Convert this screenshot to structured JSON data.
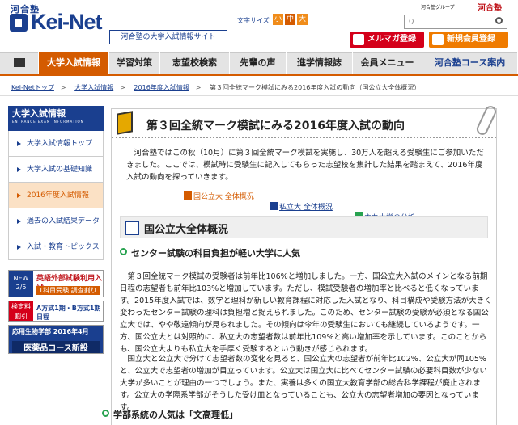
{
  "header": {
    "logo_small": "河合塾",
    "logo_text": "Kei-Net",
    "logo_sub": "河合塾の大学入試情報サイト",
    "fontsize_label": "文字サイズ",
    "fontsize_small": "小",
    "fontsize_medium": "中",
    "fontsize_large": "大",
    "group_text": "河合塾グループ",
    "group_logo": "河合塾",
    "search_placeholder": "Q",
    "magazine_button": "メルマガ登録",
    "member_button": "新規会員登録"
  },
  "nav": {
    "items": [
      "大学入試情報",
      "学習対策",
      "志望校検索",
      "先輩の声",
      "進学情報誌",
      "会員メニュー",
      "河合塾コース案内"
    ]
  },
  "breadcrumb": [
    "Kei-Netトップ",
    "大学入試情報",
    "2016年度入試情報",
    "第３回全統マーク模試にみる2016年度入試の動向（国公立大全体概況）"
  ],
  "sidebar": {
    "head_title": "大学入試情報",
    "head_sub": "ENTRANCE EXAM INFORMATION",
    "items": [
      "大学入試情報トップ",
      "大学入試の基礎知識",
      "2016年度入試情報",
      "過去の入試結果データ",
      "入試・教育トピックス"
    ],
    "banner1_key": "NEW 2/5",
    "banner1_a": "英語外部試験利用入試",
    "banner1_b": "1科目受験 調査割り",
    "banner2_key": "検定料 割引",
    "banner2_a": "A方式1期・B方式1期日程",
    "banner3_a": "応用生物学部 2016年4月",
    "banner3_b": "医薬品コース新設"
  },
  "main": {
    "title": "第３回全統マーク模試にみる2016年度入試の動向",
    "intro": "河合塾ではこの秋（10月）に第３回全統マーク模試を実施し、30万人を超える受験生にご参加いただきました。ここでは、模試時に受験生に記入してもらった志望校を集計した結果を踏まえて、2016年度入試の動向を探っていきます。",
    "tabs": [
      "国公立大 全体概況",
      "私立大 全体概況",
      "主な大学の分析"
    ],
    "section_title": "国公立大全体概況",
    "sub1": "センター試験の科目負担が軽い大学に人気",
    "para1": "第３回全統マーク模試の受験者は前年比106%と増加しました。一方、国公立大入試のメインとなる前期日程の志望者も前年比103%と増加しています。ただし、模試受験者の増加率と比べると低くなっています。2015年度入試では、数学と理科が新しい教育課程に対応した入試となり、科目構成や受験方法が大きく変わったセンター試験の理科は負担増と捉えられました。このため、センター試験の受験が必須となる国公立大では、やや敬遠傾向が見られました。その傾向は今年の受験生においても継続しているようです。一方、国公立大とは対照的に、私立大の志望者数は前年比109%と高い増加率を示しています。このことからも、国公立大よりも私立大を手厚く受験するという動きが感じられます。",
    "para2": "国立大と公立大で分けて志望者数の変化を見ると、国公立大の志望者が前年比102%、公立大が同105%と、公立大で志望者の増加が目立っています。公立大は国立大に比べてセンター試験の必要科目数が少ない大学が多いことが理由の一つでしょう。また、実養は多くの国立大教育学部の総合科学課程が廃止されます。公立大の学際系学部がそうした受け皿となっていることも、公立大の志望者増加の要因となっています。",
    "sub2": "学部系統の人気は「文高理低」"
  }
}
